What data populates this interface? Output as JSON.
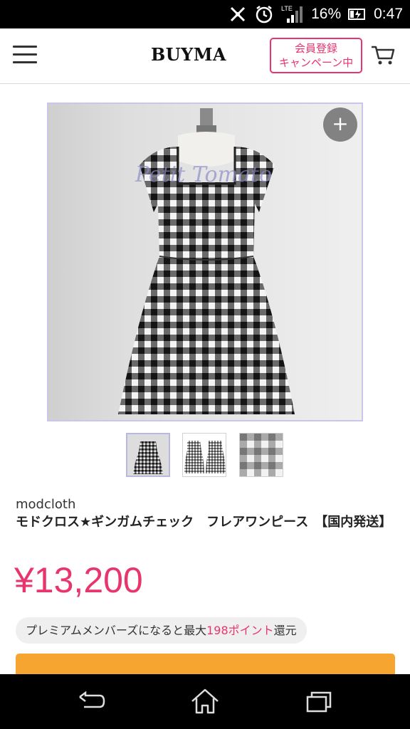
{
  "status_bar": {
    "network_label": "LTE",
    "battery": "16%",
    "time": "0:47"
  },
  "header": {
    "logo": "BUYMA",
    "campaign_line1": "会員登録",
    "campaign_line2": "キャンペーン中"
  },
  "gallery": {
    "watermark": "Petit Tomato",
    "zoom_label": "+"
  },
  "product": {
    "brand": "modcloth",
    "title": "モドクロス★ギンガムチェック　フレアワンピース　【国内発送】",
    "price": "¥13,200",
    "premium_prefix": "プレミアムメンバーズになると最大",
    "premium_points": "198ポイント",
    "premium_suffix": "還元"
  },
  "colors": {
    "accent_pink": "#e8356d",
    "cta_orange": "#f5a530",
    "gingham_dark": "#1a1a1a"
  },
  "icons": [
    "menu-icon",
    "cart-icon",
    "zoom-plus-icon",
    "back-icon",
    "home-icon",
    "recent-apps-icon",
    "clock-icon",
    "battery-icon",
    "signal-icon"
  ]
}
